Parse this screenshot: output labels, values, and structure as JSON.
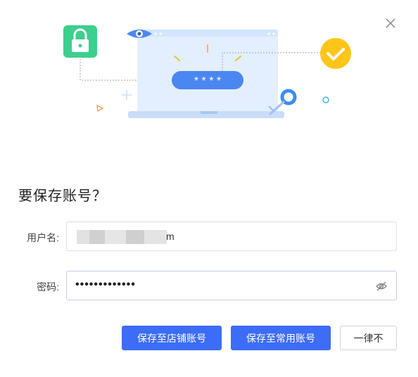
{
  "dialog": {
    "title": "要保存账号？",
    "close_icon": "close-icon"
  },
  "form": {
    "username_label": "用户名:",
    "username_visible_tail": "m",
    "password_label": "密码:",
    "password_masked": "•••••••••••••",
    "eye_icon": "eye-hidden-icon"
  },
  "buttons": {
    "save_shop": "保存至店铺账号",
    "save_common": "保存至常用账号",
    "never": "一律不"
  },
  "illustration": {
    "password_stars": "* * * *"
  },
  "colors": {
    "primary": "#3d6cf6",
    "lock_green": "#3ccf8e",
    "check_yellow": "#ffc61a",
    "key_blue": "#3b8cf6"
  }
}
